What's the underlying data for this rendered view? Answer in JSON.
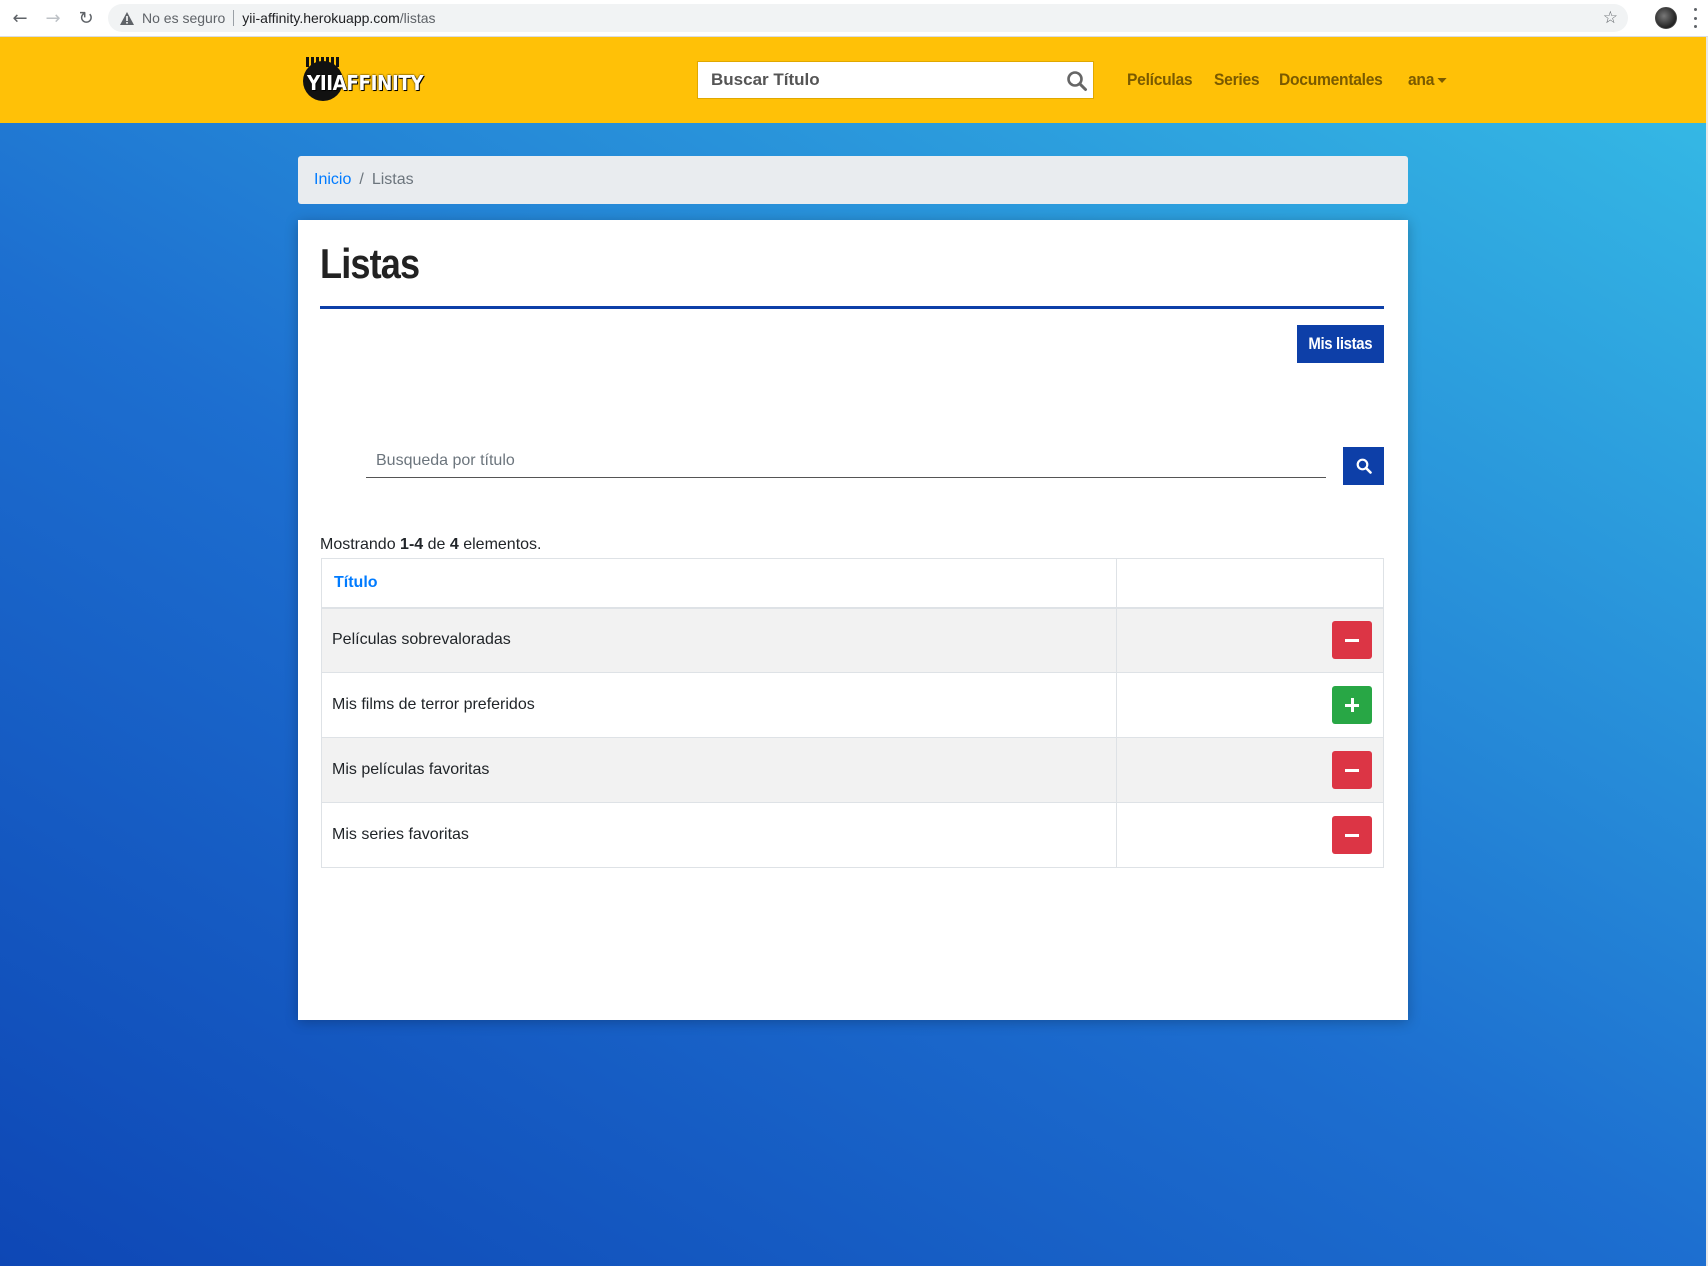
{
  "browser": {
    "not_secure_label": "No es seguro",
    "url_host": "yii-affinity.herokuapp.com",
    "url_path": "/listas",
    "back_icon": "arrow-left-icon",
    "forward_icon": "arrow-right-icon",
    "reload_icon": "reload-icon"
  },
  "navbar": {
    "logo_text": "YIIAFFINITY",
    "search_placeholder": "Buscar Título",
    "links": [
      "Películas",
      "Series",
      "Documentales"
    ],
    "user": "ana",
    "background": "#ffc107"
  },
  "breadcrumb": {
    "home": "Inicio",
    "separator": "/",
    "current": "Listas"
  },
  "page": {
    "title": "Listas",
    "my_lists_button": "Mis listas",
    "search_placeholder": "Busqueda por título",
    "summary_prefix": "Mostrando ",
    "summary_range": "1-4",
    "summary_mid": " de ",
    "summary_total": "4",
    "summary_suffix": " elementos."
  },
  "table": {
    "header_title": "Título",
    "header_actions": "",
    "rows": [
      {
        "title": "Películas sobrevaloradas",
        "action": "remove"
      },
      {
        "title": "Mis films de terror preferidos",
        "action": "add"
      },
      {
        "title": "Mis películas favoritas",
        "action": "remove"
      },
      {
        "title": "Mis series favoritas",
        "action": "remove"
      }
    ]
  },
  "colors": {
    "accent": "#0d3fa8",
    "danger": "#dc3545",
    "success": "#28a745",
    "link": "#007bff"
  }
}
